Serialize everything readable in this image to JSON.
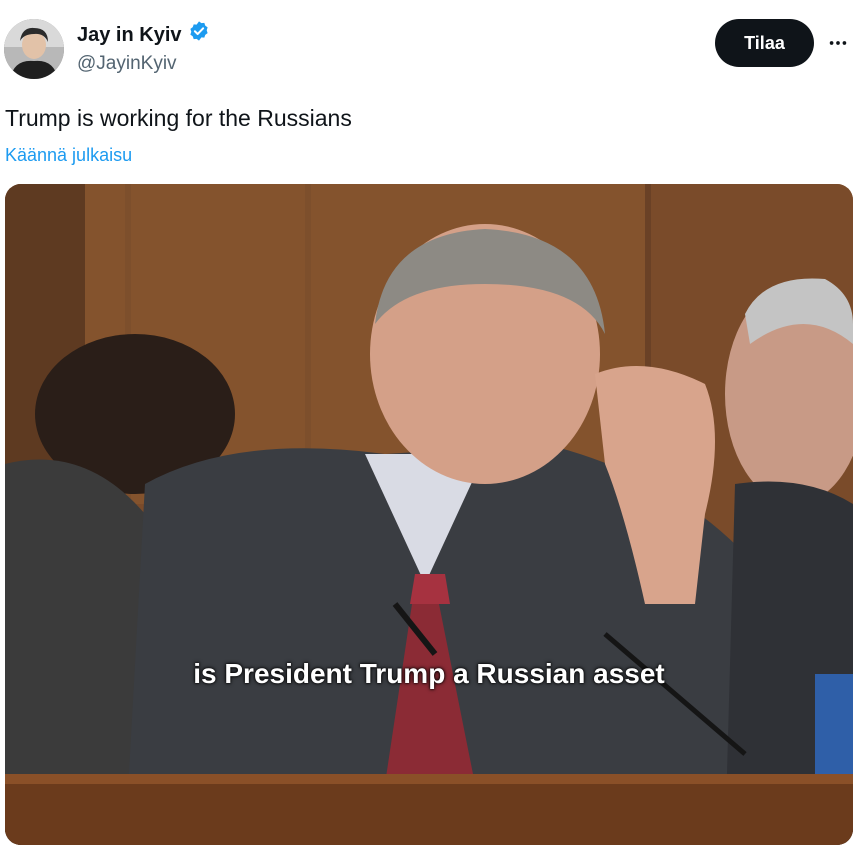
{
  "author": {
    "display_name": "Jay in Kyiv",
    "handle": "@JayinKyiv",
    "verified_icon": "verified-badge-icon"
  },
  "actions": {
    "subscribe_label": "Tilaa",
    "more_icon": "more-horizontal-icon"
  },
  "tweet": {
    "text": "Trump is working for the Russians",
    "translate_label": "Käännä julkaisu"
  },
  "media": {
    "subtitle": "is President Trump a Russian asset"
  },
  "colors": {
    "accent": "#1d9bf0",
    "button_bg": "#0f1419",
    "secondary_text": "#536471"
  }
}
